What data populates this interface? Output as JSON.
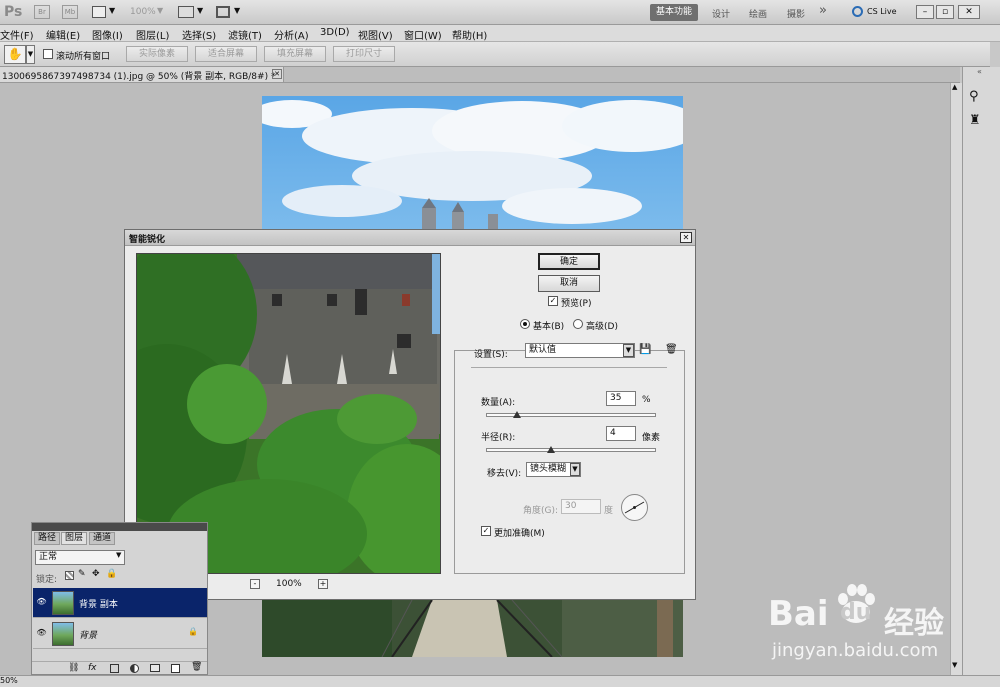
{
  "app": {
    "logo": "Ps",
    "zoom": "100%",
    "workspaces": [
      "基本功能",
      "设计",
      "绘画",
      "摄影"
    ],
    "more": "»",
    "cs_live": "CS Live"
  },
  "menu": [
    "文件(F)",
    "编辑(E)",
    "图像(I)",
    "图层(L)",
    "选择(S)",
    "滤镜(T)",
    "分析(A)",
    "3D(D)",
    "视图(V)",
    "窗口(W)",
    "帮助(H)"
  ],
  "options": {
    "scroll_all": "滚动所有窗口",
    "buttons": [
      "实际像素",
      "适合屏幕",
      "填充屏幕",
      "打印尺寸"
    ]
  },
  "document": {
    "tab_title": "1300695867397498734 (1).jpg @ 50% (背景 副本, RGB/8#) *"
  },
  "dialog": {
    "title": "智能锐化",
    "ok": "确定",
    "cancel": "取消",
    "preview": "预览(P)",
    "preview_checked": true,
    "mode_basic": "基本(B)",
    "mode_advanced": "高级(D)",
    "mode_selected": "basic",
    "settings_label": "设置(S):",
    "settings_value": "默认值",
    "amount_label": "数量(A):",
    "amount_value": "35",
    "amount_unit": "%",
    "amount_fraction": 0.35,
    "radius_label": "半径(R):",
    "radius_value": "4",
    "radius_unit": "像素",
    "radius_fraction": 0.63,
    "remove_label": "移去(V):",
    "remove_value": "镜头模糊",
    "angle_label": "角度(G):",
    "angle_value": "30",
    "angle_unit": "度",
    "more_accurate": "更加准确(M)",
    "more_accurate_checked": true,
    "zoom": "100%",
    "zoom_minus": "-",
    "zoom_plus": "+"
  },
  "layers_panel": {
    "tabs": [
      "路径",
      "图层",
      "通道"
    ],
    "blend_mode": "正常",
    "lock_label": "锁定:",
    "layers": [
      {
        "name": "背景 副本",
        "selected": true
      },
      {
        "name": "背景",
        "selected": false
      }
    ]
  },
  "status": {
    "zoom": "50%"
  },
  "watermark": {
    "brand_a": "Bai",
    "brand_b": "du",
    "brand_cn": "经验",
    "url": "jingyan.baidu.com"
  },
  "colors": {
    "selection": "#0a246a",
    "panel": "#d4d4d4",
    "sky": "#5aa6e6"
  }
}
